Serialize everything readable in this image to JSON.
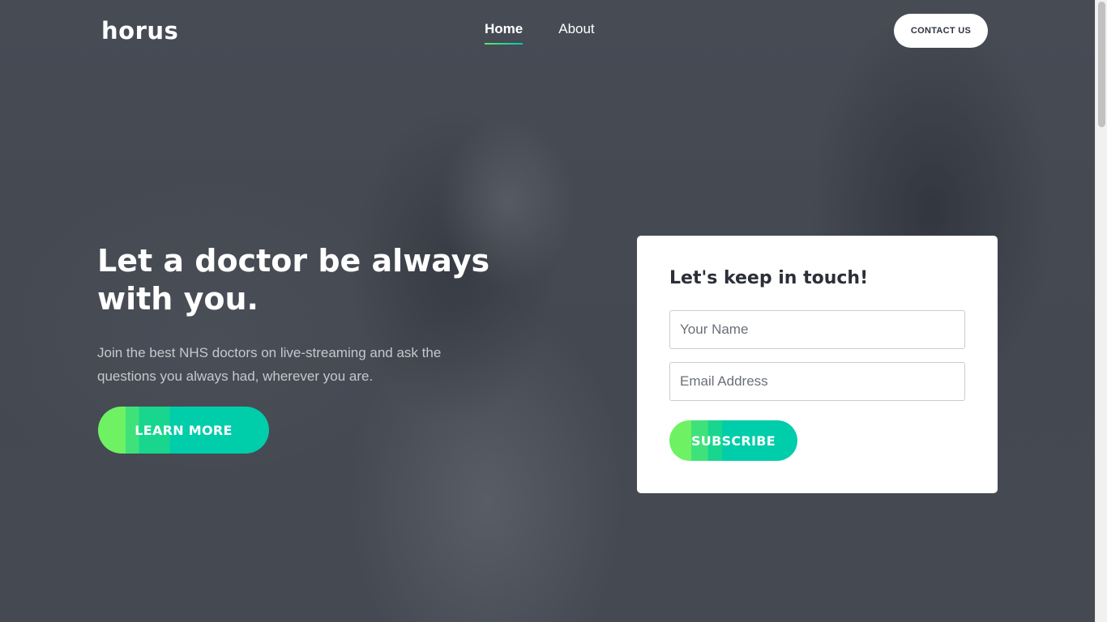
{
  "header": {
    "logo": "horus",
    "nav": [
      {
        "label": "Home",
        "active": true
      },
      {
        "label": "About",
        "active": false
      }
    ],
    "contact_label": "CONTACT US"
  },
  "hero": {
    "title_line1": "Let a doctor be always",
    "title_line2": "with you.",
    "subtitle_line1": "Join the best NHS doctors on live-streaming and ask the",
    "subtitle_line2": "questions you always had, wherever you are.",
    "cta_label": "LEARN MORE"
  },
  "form": {
    "title": "Let's keep in touch!",
    "name_placeholder": "Your Name",
    "name_value": "",
    "email_placeholder": "Email Address",
    "email_value": "",
    "submit_label": "SUBSCRIBE"
  },
  "colors": {
    "accent_green": "#6ef264",
    "accent_teal": "#00cda9",
    "background": "#474c56",
    "card": "#ffffff",
    "heading_dark": "#2b2f38"
  },
  "icons": {
    "background": "doctor-photo-background"
  }
}
